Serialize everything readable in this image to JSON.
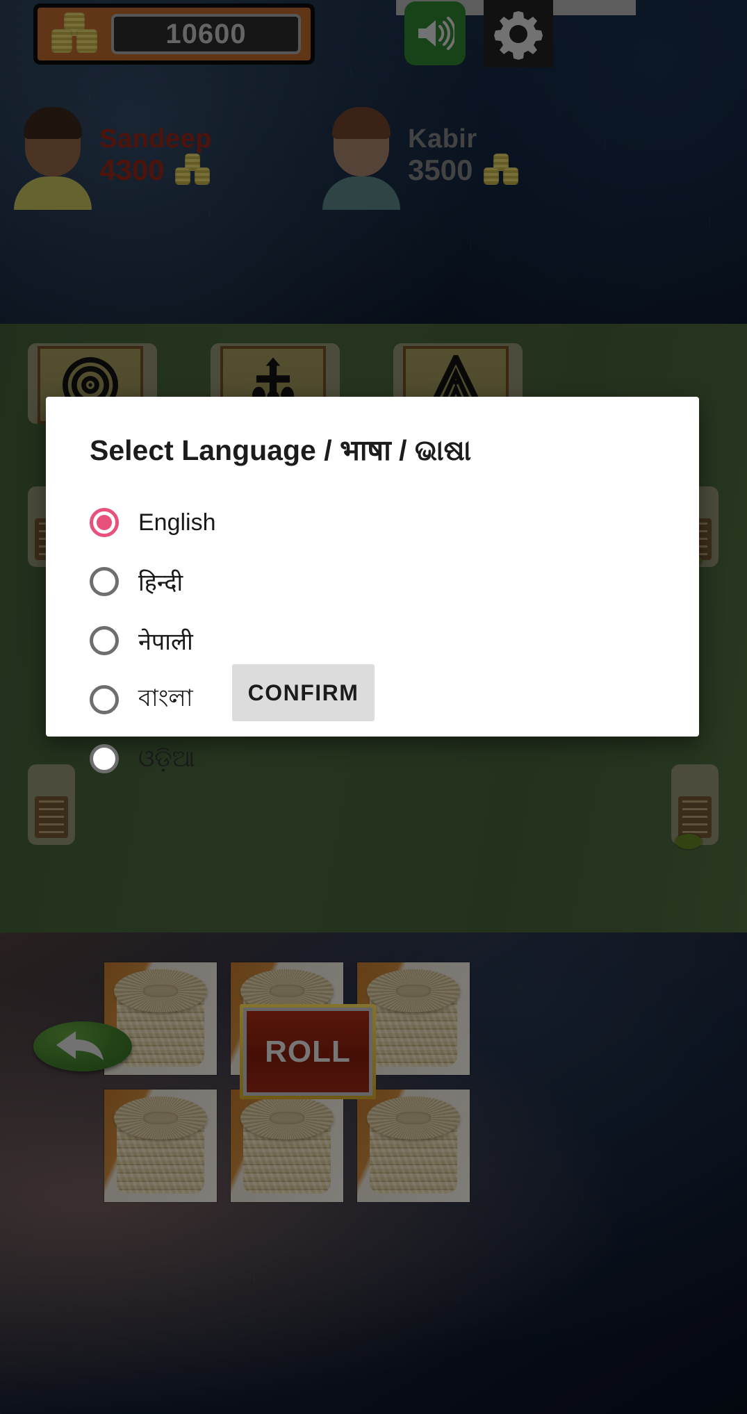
{
  "topbar": {
    "coin_total": "10600",
    "coin_icon": "coin-stack-icon",
    "sound_icon": "speaker-on-icon",
    "settings_icon": "gear-icon"
  },
  "players": [
    {
      "name": "Sandeep",
      "score": "4300",
      "color": "#8e2415",
      "coin_icon": "coin-stack-icon"
    },
    {
      "name": "Kabir",
      "score": "3500",
      "color": "#7a7a7a",
      "coin_icon": "coin-stack-icon"
    }
  ],
  "board": {
    "cards": [
      {
        "symbol_name": "concentric-circles-icon"
      },
      {
        "symbol_name": "cross-tree-icon"
      },
      {
        "symbol_name": "triangle-chevron-icon"
      }
    ]
  },
  "baskets": {
    "count": 6,
    "label": "wicker-basket-image"
  },
  "controls": {
    "roll_label": "ROLL",
    "undo_icon": "undo-arrow-icon"
  },
  "dialog": {
    "title": "Select Language / भाषा / ଭାଷା",
    "options": [
      {
        "label": "English",
        "selected": true
      },
      {
        "label": "हिन्दी",
        "selected": false
      },
      {
        "label": "नेपाली",
        "selected": false
      },
      {
        "label": "বাংলা",
        "selected": false
      },
      {
        "label": "ଓଡ଼ିଆ",
        "selected": false
      }
    ],
    "confirm_label": "CONFIRM",
    "accent_color": "#e8517c",
    "confirm_bg": "#dcdcdc"
  }
}
